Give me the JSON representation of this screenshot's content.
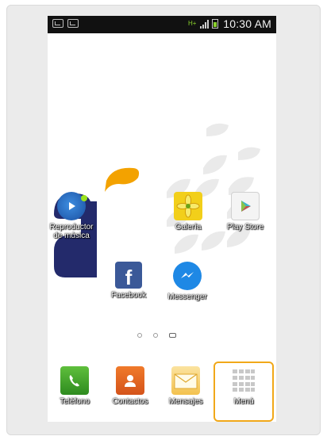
{
  "status_bar": {
    "time": "10:30 AM",
    "network": "H+"
  },
  "home_apps": [
    {
      "label": "Reproductor\nde música",
      "icon": "music-player-icon"
    },
    {
      "label": "Galería",
      "icon": "gallery-icon"
    },
    {
      "label": "Play Store",
      "icon": "play-store-icon"
    },
    {
      "label": "Facebook",
      "icon": "facebook-icon"
    },
    {
      "label": "Messenger",
      "icon": "messenger-icon"
    }
  ],
  "page_indicator": {
    "pages": 3,
    "current": 3
  },
  "dock": [
    {
      "label": "Teléfono",
      "icon": "phone-icon"
    },
    {
      "label": "Contactos",
      "icon": "contacts-icon"
    },
    {
      "label": "Mensajes",
      "icon": "messages-icon"
    },
    {
      "label": "Menú",
      "icon": "app-menu-icon"
    }
  ],
  "colors": {
    "highlight": "#f1a819",
    "brand_navy": "#232a6b",
    "brand_orange": "#f3a200"
  }
}
